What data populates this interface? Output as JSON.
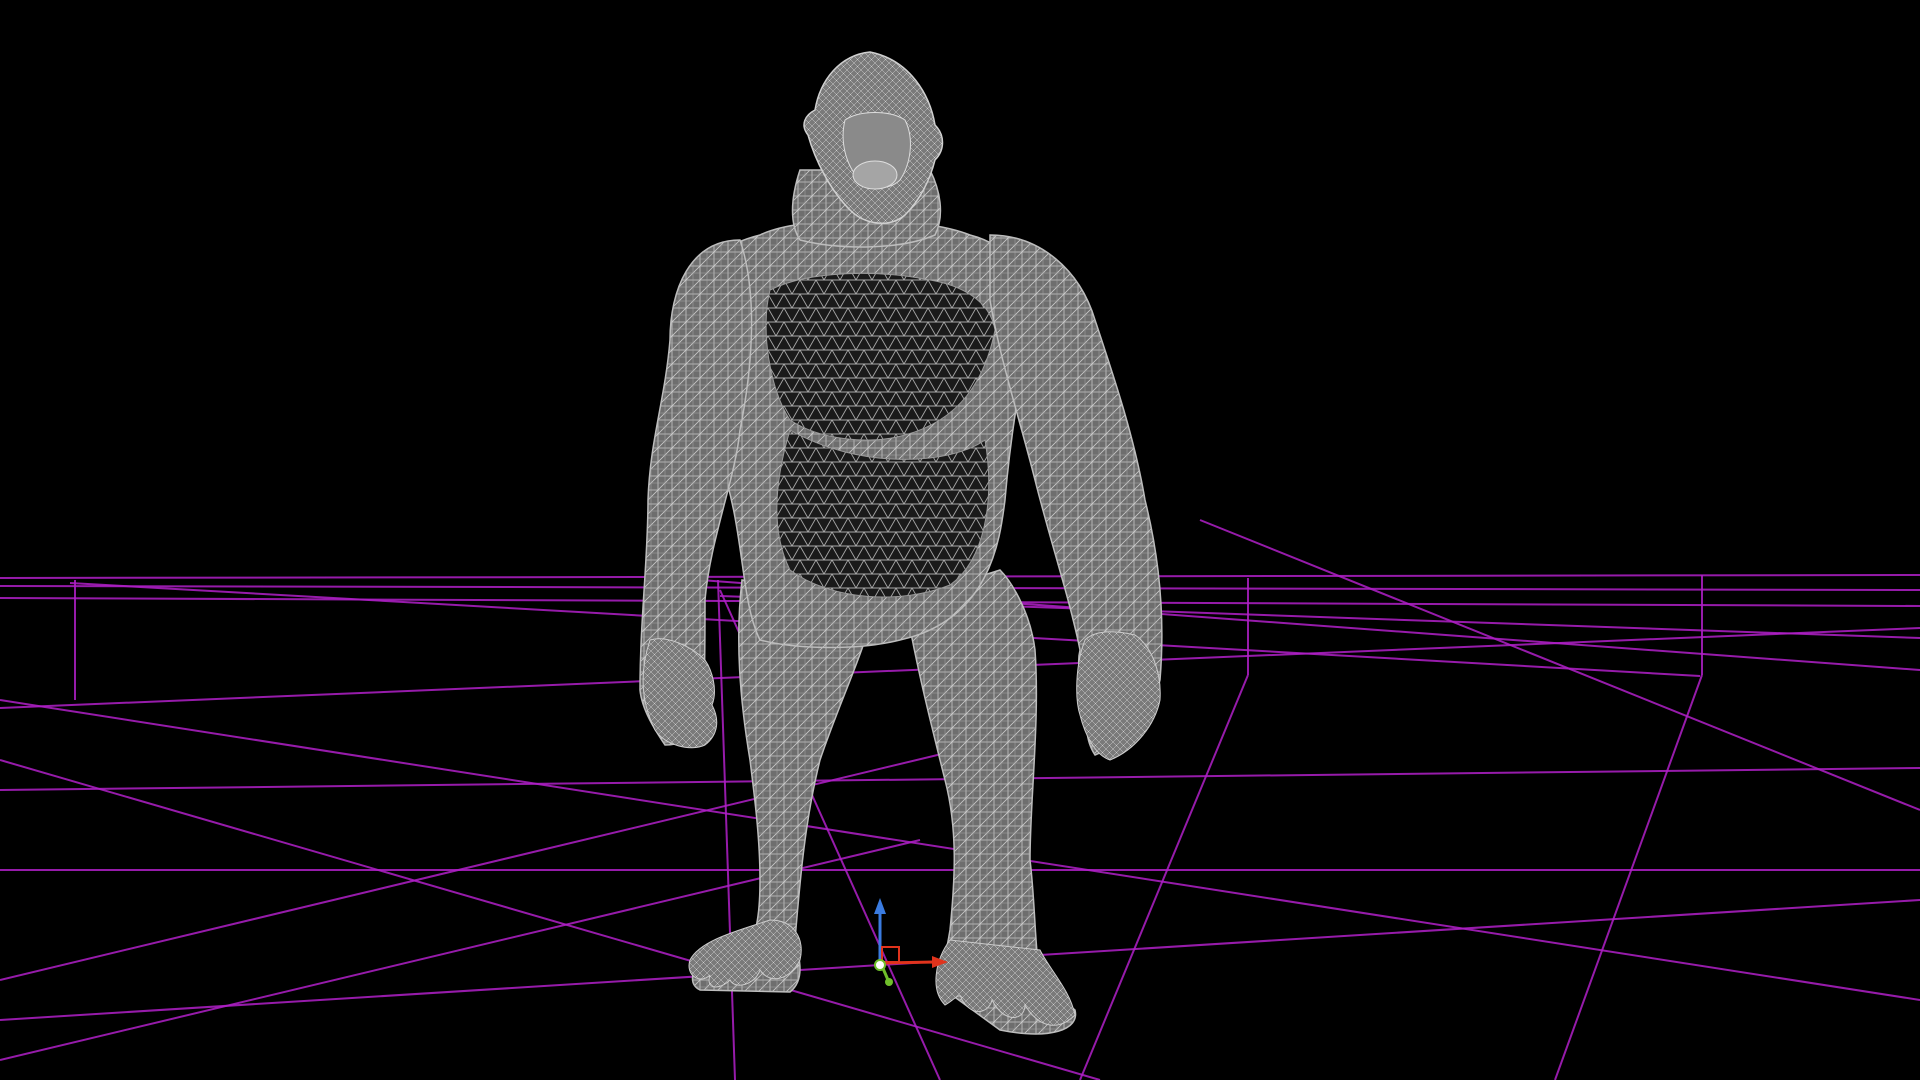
{
  "viewport": {
    "background_color": "#000000",
    "mode": "wireframe",
    "model_name": "gorilla-icon",
    "model_color": "#9a9a9a",
    "model_line_color": "#c8c8c8",
    "grid_color": "#b020c8",
    "gizmo": {
      "x_axis_color": "#e0331c",
      "y_axis_color": "#6fbf2a",
      "z_axis_color": "#3a7be0",
      "origin_color": "#ffffff"
    }
  }
}
